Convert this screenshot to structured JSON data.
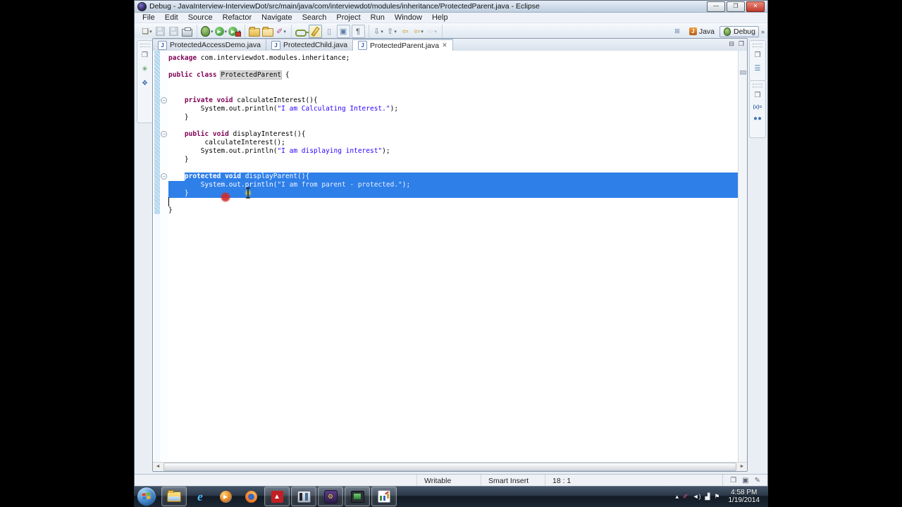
{
  "window": {
    "title": "Debug - JavaInterview-InterviewDot/src/main/java/com/interviewdot/modules/inheritance/ProtectedParent.java - Eclipse",
    "controls": {
      "minimize": "—",
      "maximize": "❐",
      "close": "✕"
    }
  },
  "menu": {
    "items": [
      "File",
      "Edit",
      "Source",
      "Refactor",
      "Navigate",
      "Search",
      "Project",
      "Run",
      "Window",
      "Help"
    ]
  },
  "toolbar": {
    "groups": [
      [
        {
          "name": "new-wizard-button",
          "glyph": "❏",
          "color": "#6b5530",
          "dropdown": true
        },
        {
          "name": "save-button",
          "kind": "floppy",
          "disabled": true
        },
        {
          "name": "save-all-button",
          "kind": "floppy",
          "disabled": true
        },
        {
          "name": "print-button",
          "kind": "printer"
        }
      ],
      [
        {
          "name": "debug-button",
          "kind": "bug",
          "dropdown": true
        },
        {
          "name": "run-button",
          "kind": "run",
          "dropdown": true
        },
        {
          "name": "external-tools-button",
          "kind": "ext",
          "dropdown": true
        }
      ],
      [
        {
          "name": "open-type-button",
          "kind": "folder"
        },
        {
          "name": "open-resource-button",
          "kind": "folder2"
        },
        {
          "name": "search-button",
          "glyph": "✐",
          "color": "#b5487a",
          "dropdown": true
        }
      ],
      [
        {
          "name": "externalize-strings-button",
          "kind": "key"
        },
        {
          "name": "mark-occurrences-button",
          "kind": "pen",
          "active": true
        },
        {
          "name": "block-selection-button",
          "glyph": "▯",
          "color": "#8a94a2"
        },
        {
          "name": "show-source-button",
          "glyph": "▣",
          "color": "#5a7fae",
          "boxed": true
        },
        {
          "name": "show-whitespace-button",
          "glyph": "¶",
          "color": "#55606e",
          "boxed": true
        }
      ],
      [
        {
          "name": "next-annotation-button",
          "glyph": "⇩",
          "color": "#6b7686",
          "dropdown": true
        },
        {
          "name": "previous-annotation-button",
          "glyph": "⇧",
          "color": "#6b7686",
          "dropdown": true
        },
        {
          "name": "last-edit-location-button",
          "glyph": "⇦",
          "color": "#caa53d"
        },
        {
          "name": "back-button",
          "glyph": "⇦",
          "color": "#caa53d",
          "dropdown": true
        },
        {
          "name": "forward-button",
          "glyph": "⇨",
          "color": "#aab2bd",
          "disabled": true,
          "dropdown": true
        }
      ]
    ]
  },
  "perspectives": {
    "open_button_glyph": "⊞",
    "items": [
      {
        "label": "Java",
        "active": false
      },
      {
        "label": "Debug",
        "active": true
      }
    ],
    "overflow": "»"
  },
  "tabs": [
    {
      "label": "ProtectedAccessDemo.java",
      "active": false
    },
    {
      "label": "ProtectedChild.java",
      "active": false
    },
    {
      "label": "ProtectedParent.java",
      "active": true,
      "close": "✕"
    }
  ],
  "stack_controls": {
    "minimize": "⊟",
    "maximize": "❐"
  },
  "editor": {
    "lines": [
      {
        "tokens": [
          {
            "t": "package",
            "c": "kw"
          },
          {
            "t": " com.interviewdot.modules.inheritance;",
            "c": "p"
          }
        ]
      },
      {
        "tokens": []
      },
      {
        "tokens": [
          {
            "t": "public class ",
            "c": "kw"
          },
          {
            "t": "ProtectedParent",
            "c": "occ"
          },
          {
            "t": " {",
            "c": "p"
          }
        ]
      },
      {
        "tokens": []
      },
      {
        "tokens": []
      },
      {
        "fold": true,
        "tokens": [
          {
            "t": "    ",
            "c": "p"
          },
          {
            "t": "private void",
            "c": "kw"
          },
          {
            "t": " calculateInterest(){",
            "c": "p"
          }
        ]
      },
      {
        "tokens": [
          {
            "t": "        System.out.println(",
            "c": "p"
          },
          {
            "t": "\"I am Calculating Interest.\"",
            "c": "str"
          },
          {
            "t": ");",
            "c": "p"
          }
        ]
      },
      {
        "tokens": [
          {
            "t": "    }",
            "c": "p"
          }
        ]
      },
      {
        "tokens": []
      },
      {
        "fold": true,
        "tokens": [
          {
            "t": "    ",
            "c": "p"
          },
          {
            "t": "public void",
            "c": "kw"
          },
          {
            "t": " displayInterest(){",
            "c": "p"
          }
        ]
      },
      {
        "tokens": [
          {
            "t": "         calculateInterest();",
            "c": "p"
          }
        ]
      },
      {
        "tokens": [
          {
            "t": "        System.out.println(",
            "c": "p"
          },
          {
            "t": "\"I am displaying interest\"",
            "c": "str"
          },
          {
            "t": ");",
            "c": "p"
          }
        ]
      },
      {
        "tokens": [
          {
            "t": "    }",
            "c": "p"
          }
        ]
      },
      {
        "tokens": []
      },
      {
        "fold": true,
        "sel": "text",
        "tokens": [
          {
            "t": "    ",
            "c": "p"
          },
          {
            "t": "protected void",
            "c": "kw"
          },
          {
            "t": " displayParent(){",
            "c": "p"
          }
        ]
      },
      {
        "sel": "full",
        "tokens": [
          {
            "t": "        System.out.println(",
            "c": "p"
          },
          {
            "t": "\"I am from parent - protected.\"",
            "c": "str"
          },
          {
            "t": ");",
            "c": "p"
          }
        ]
      },
      {
        "sel": "full",
        "tokens": [
          {
            "t": "    }",
            "c": "p"
          }
        ]
      },
      {
        "caret": true,
        "tokens": []
      },
      {
        "tokens": [
          {
            "t": "}",
            "c": "p"
          }
        ]
      }
    ],
    "scroll": {
      "left_arrow": "◄",
      "right_arrow": "►"
    }
  },
  "left_rail": [
    {
      "name": "restore-views-icon",
      "glyph": "❐",
      "color": "#5a6675"
    },
    {
      "name": "debug-view-icon",
      "glyph": "✳",
      "color": "#3f8d3f"
    },
    {
      "name": "servers-view-icon",
      "glyph": "❖",
      "color": "#3f6fae"
    }
  ],
  "right_rail_top": [
    {
      "name": "restore-views-icon",
      "glyph": "❐",
      "color": "#5a6675"
    },
    {
      "name": "outline-view-icon",
      "glyph": "☰",
      "color": "#4a78b5"
    }
  ],
  "right_rail_bottom": [
    {
      "name": "restore-views-icon",
      "glyph": "❐",
      "color": "#5a6675"
    },
    {
      "name": "variables-view-icon",
      "text": "(x)=",
      "color": "#3b66a0"
    },
    {
      "name": "breakpoints-view-icon",
      "glyph": "●●",
      "color": "#4a78b5"
    }
  ],
  "status": {
    "writable": "Writable",
    "insert_mode": "Smart Insert",
    "position": "18 : 1",
    "icons": [
      {
        "name": "restore-trim-icon",
        "glyph": "❐"
      },
      {
        "name": "console-trim-icon",
        "glyph": "▣"
      },
      {
        "name": "tasks-trim-icon",
        "glyph": "✎"
      }
    ]
  },
  "taskbar": {
    "items": [
      {
        "name": "windows-explorer",
        "icon": "ti-folder",
        "running": true
      },
      {
        "name": "internet-explorer",
        "icon": "ti-ie",
        "running": false,
        "glyph": "e"
      },
      {
        "name": "media-player",
        "icon": "ti-wmp",
        "running": false,
        "glyph": "▶"
      },
      {
        "name": "firefox",
        "icon": "ti-ff",
        "running": false
      },
      {
        "name": "adobe-reader",
        "icon": "ti-adobe",
        "running": true,
        "glyph": "▲"
      },
      {
        "name": "movie-maker",
        "icon": "ti-movie",
        "running": true
      },
      {
        "name": "eclipse-ide",
        "icon": "ti-eclipse",
        "running": true,
        "glyph": "⚙"
      },
      {
        "name": "screen-recorder",
        "icon": "ti-rec",
        "running": true
      },
      {
        "name": "chart-tool",
        "icon": "ti-chart",
        "running": true
      }
    ],
    "tray": {
      "icons": [
        {
          "name": "show-hidden-icons",
          "glyph": "▴"
        },
        {
          "name": "recorder-tray-icon",
          "glyph": "✐",
          "color": "#e0608a"
        },
        {
          "name": "volume-icon",
          "glyph": "◄)"
        },
        {
          "name": "network-icon",
          "glyph": "▟"
        },
        {
          "name": "action-center-icon",
          "glyph": "⚑"
        }
      ],
      "time": "4:58 PM",
      "date": "1/19/2014"
    }
  },
  "colors": {
    "selection": "#2e7fe8",
    "keyword": "#7f0055",
    "string": "#2a00ff"
  }
}
